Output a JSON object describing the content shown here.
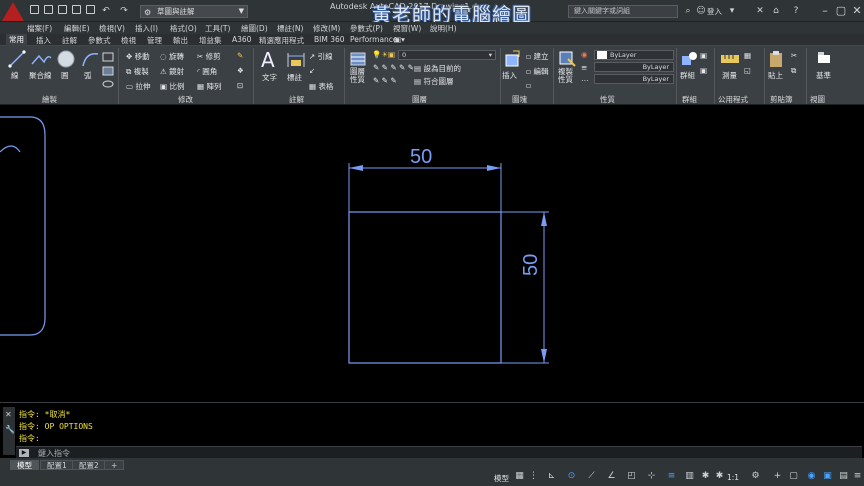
{
  "titlebar": {
    "workspace": "草圖與註解",
    "title": "Autodesk AutoCAD 2017   Drawing1.dwg",
    "watermark": "黃老師的電腦繪圖",
    "search_placeholder": "鍵入關鍵字或詞組",
    "login": "登入"
  },
  "menu": {
    "items": [
      "檔案(F)",
      "編輯(E)",
      "檢視(V)",
      "插入(I)",
      "格式(O)",
      "工具(T)",
      "繪圖(D)",
      "標註(N)",
      "修改(M)",
      "參數式(P)",
      "視窗(W)",
      "說明(H)"
    ]
  },
  "ribbon_tabs": {
    "items": [
      "常用",
      "插入",
      "註解",
      "參數式",
      "檢視",
      "管理",
      "輸出",
      "增益集",
      "A360",
      "精選應用程式",
      "BIM 360",
      "Performance"
    ]
  },
  "ribbon": {
    "draw": {
      "title": "繪製",
      "line": "線",
      "polyline": "聚合線",
      "circle": "圓",
      "arc": "弧"
    },
    "modify": {
      "title": "修改",
      "move": "移動",
      "rotate": "旋轉",
      "trim": "修剪",
      "copy": "複製",
      "mirror": "鏡射",
      "fillet": "圓角",
      "stretch": "拉伸",
      "scale": "比例",
      "array": "陣列"
    },
    "annotation": {
      "title": "註解",
      "text": "文字",
      "dimension": "標註",
      "leader": "引線",
      "table": "表格"
    },
    "layers": {
      "title": "圖層",
      "layer_props": "圖層\n性質",
      "layer_dropdown": "0",
      "make_current": "設為目前的",
      "match_layer": "符合圖層"
    },
    "block": {
      "title": "圖塊",
      "insert": "插入",
      "create": "建立",
      "edit": "編輯"
    },
    "properties": {
      "title": "性質",
      "match": "複製\n性質",
      "color": "ByLayer",
      "lineweight": "ByLayer",
      "linetype": "ByLayer"
    },
    "groups": {
      "title": "群組",
      "group": "群組"
    },
    "utilities": {
      "title": "公用程式",
      "measure": "測量"
    },
    "clipboard": {
      "title": "剪貼簿",
      "paste": "貼上"
    },
    "view": {
      "title": "視圖",
      "base": "基準"
    }
  },
  "drawing": {
    "dim_horizontal": "50",
    "dim_vertical": "50",
    "line_color": "#7a9cf5"
  },
  "command": {
    "lines": [
      "指令: *取消*",
      "指令: OP OPTIONS",
      "指令:"
    ],
    "placeholder": "鍵入指令"
  },
  "status": {
    "layout_tabs": [
      "模型",
      "配置1",
      "配置2"
    ],
    "model": "模型",
    "scale": "1:1"
  }
}
